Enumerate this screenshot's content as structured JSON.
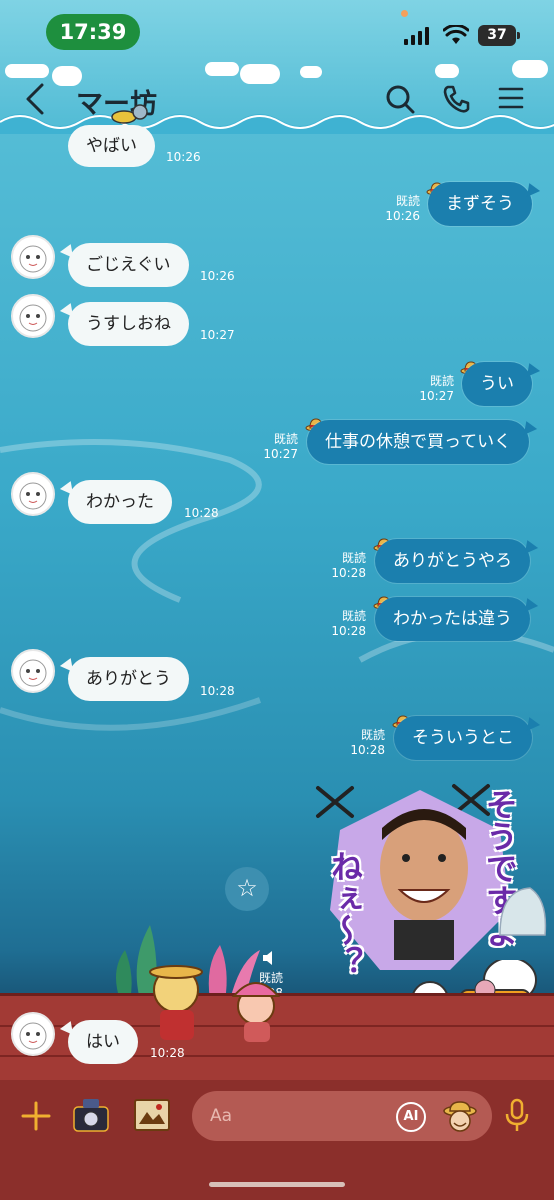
{
  "status_bar": {
    "time": "17:39",
    "battery": "37"
  },
  "header": {
    "title": "マー坊"
  },
  "messages": [
    {
      "dir": "in",
      "text": "やばい",
      "time": "10:26"
    },
    {
      "dir": "out",
      "text": "まずそう",
      "read": "既読",
      "time": "10:26"
    },
    {
      "dir": "in",
      "text": "ごじえぐい",
      "time": "10:26"
    },
    {
      "dir": "in",
      "text": "うすしおね",
      "time": "10:27"
    },
    {
      "dir": "out",
      "text": "うい",
      "read": "既読",
      "time": "10:27"
    },
    {
      "dir": "out",
      "text": "仕事の休憩で買っていく",
      "read": "既読",
      "time": "10:27"
    },
    {
      "dir": "in",
      "text": "わかった",
      "time": "10:28"
    },
    {
      "dir": "out",
      "text": "ありがとうやろ",
      "read": "既読",
      "time": "10:28"
    },
    {
      "dir": "out",
      "text": "わかったは違う",
      "read": "既読",
      "time": "10:28"
    },
    {
      "dir": "in",
      "text": "ありがとう",
      "time": "10:28"
    },
    {
      "dir": "out",
      "text": "そういうとこ",
      "read": "既読",
      "time": "10:28"
    },
    {
      "dir": "out_sticker",
      "sticker_text_1": "そうですよ",
      "sticker_text_2": "ねぇ〜？",
      "read": "既読",
      "time": "10:28"
    },
    {
      "dir": "in",
      "text": "はい",
      "time": "10:28"
    }
  ],
  "composer": {
    "placeholder": "Aa",
    "ai_label": "AI"
  },
  "icons": [
    "back-icon",
    "search-icon",
    "phone-icon",
    "menu-icon",
    "plus-icon",
    "camera-icon",
    "photo-icon",
    "star-icon",
    "ai-icon",
    "sticker-icon",
    "mic-icon"
  ],
  "colors": {
    "out_bubble": "#1b7fae",
    "in_bubble": "#f3f8f8",
    "floor": "#a23a35",
    "bottom_bar": "#8b2f2b",
    "time_pill": "#1e8f3e"
  }
}
